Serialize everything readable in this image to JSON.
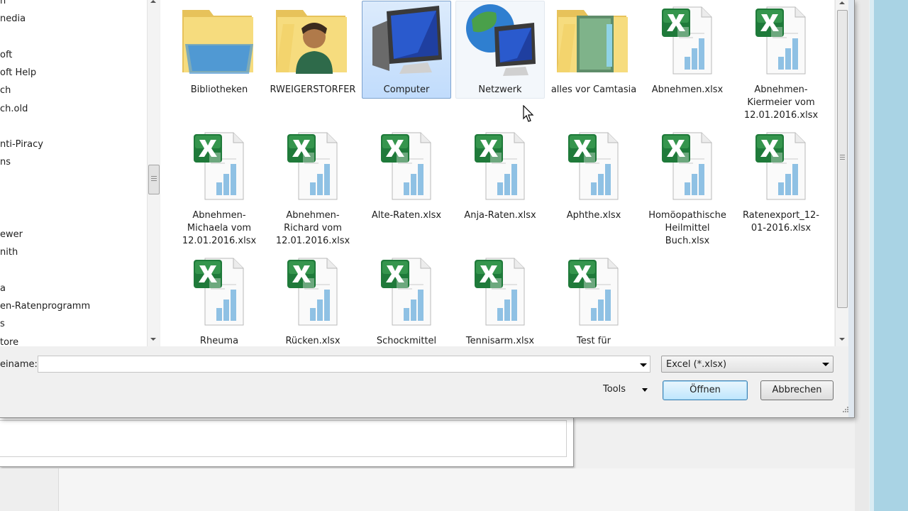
{
  "navigation": {
    "items": [
      "n",
      "nedia",
      "oft",
      "oft Help",
      "ch",
      "ch.old",
      "nti-Piracy",
      "ns",
      "ewer",
      "nith",
      "a",
      "en-Ratenprogramm",
      "s",
      "tore"
    ]
  },
  "files": [
    {
      "label": "Bibliotheken",
      "icon": "libraries-folder-icon",
      "selected": false
    },
    {
      "label": "RWEIGERSTORFER",
      "icon": "user-folder-icon",
      "selected": false
    },
    {
      "label": "Computer",
      "icon": "computer-icon",
      "selected": true
    },
    {
      "label": "Netzwerk",
      "icon": "network-icon",
      "selected": false,
      "hover": true
    },
    {
      "label": "alles vor Camtasia",
      "icon": "folder-icon",
      "selected": false
    },
    {
      "label": "Abnehmen.xlsx",
      "icon": "excel-file-icon",
      "selected": false
    },
    {
      "label": "Abnehmen-Kiermeier vom 12.01.2016.xlsx",
      "icon": "excel-file-icon",
      "selected": false
    },
    {
      "label": "Abnehmen-Michaela vom 12.01.2016.xlsx",
      "icon": "excel-file-icon",
      "selected": false
    },
    {
      "label": "Abnehmen-Richard vom 12.01.2016.xlsx",
      "icon": "excel-file-icon",
      "selected": false
    },
    {
      "label": "Alte-Raten.xlsx",
      "icon": "excel-file-icon",
      "selected": false
    },
    {
      "label": "Anja-Raten.xlsx",
      "icon": "excel-file-icon",
      "selected": false
    },
    {
      "label": "Aphthe.xlsx",
      "icon": "excel-file-icon",
      "selected": false
    },
    {
      "label": "Homöopathische Heilmittel Buch.xlsx",
      "icon": "excel-file-icon",
      "selected": false
    },
    {
      "label": "Ratenexport_12-01-2016.xlsx",
      "icon": "excel-file-icon",
      "selected": false
    },
    {
      "label": "Rheuma",
      "icon": "excel-file-icon",
      "selected": false
    },
    {
      "label": "Rücken.xlsx",
      "icon": "excel-file-icon",
      "selected": false
    },
    {
      "label": "Schockmittel",
      "icon": "excel-file-icon",
      "selected": false
    },
    {
      "label": "Tennisarm.xlsx",
      "icon": "excel-file-icon",
      "selected": false
    },
    {
      "label": "Test für",
      "icon": "excel-file-icon",
      "selected": false
    }
  ],
  "filename": {
    "label": "einame:",
    "value": ""
  },
  "filter": {
    "selected": "Excel (*.xlsx)"
  },
  "buttons": {
    "tools": "Tools",
    "open": "Öffnen",
    "cancel": "Abbrechen"
  },
  "colors": {
    "selection": "#cce4fb",
    "excel_green": "#1f7a3a",
    "folder_yellow": "#f3d36b",
    "taskbar_blue": "#a9d3e4"
  }
}
